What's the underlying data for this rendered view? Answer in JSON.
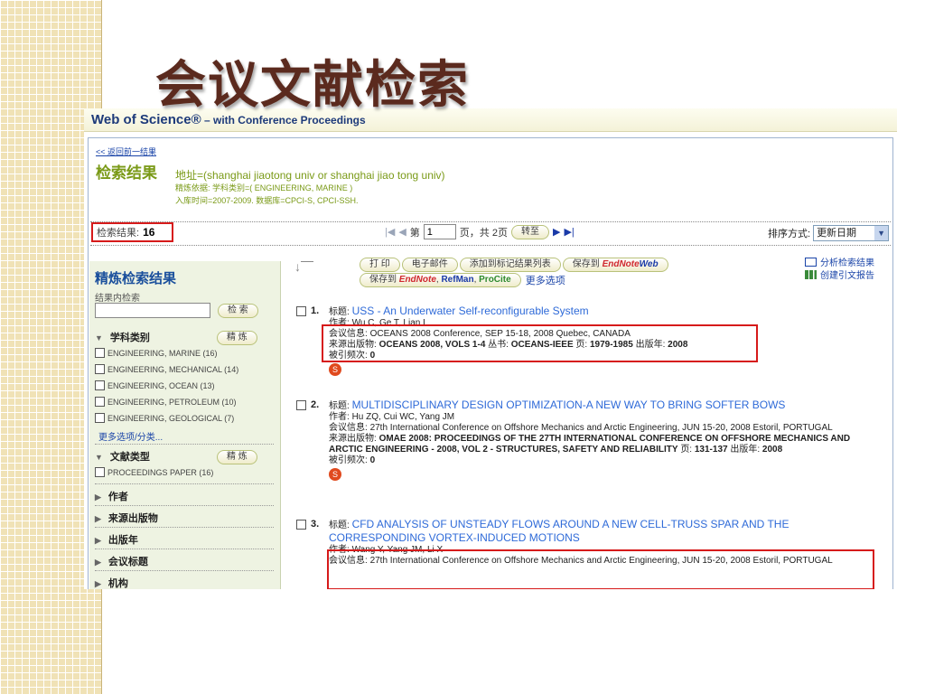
{
  "slide": {
    "title": "会议文献检索"
  },
  "wos": {
    "brand": "Web of Science®",
    "subtitle": " – with Conference Proceedings"
  },
  "results": {
    "back_link": "<< 返回前一结果",
    "heading": "检索结果",
    "query": "地址=(shanghai jiaotong univ or shanghai jiao tong univ)",
    "refine": "精炼依据: 学科类别=( ENGINEERING, MARINE )",
    "date_range": "入库时间=2007-2009. 数据库=CPCI-S, CPCI-SSH.",
    "count_label": "检索结果:",
    "count_value": "16"
  },
  "pager": {
    "prefix": "第",
    "page": "1",
    "suffix": "页，共 2页",
    "go_label": "转至"
  },
  "sort": {
    "label": "排序方式:",
    "value": "更新日期"
  },
  "sidebar": {
    "title": "精炼检索结果",
    "search_label": "结果内检索",
    "search_btn": "检 索",
    "refine_btn": "精 炼",
    "subject": {
      "label": "学科类别",
      "items": [
        "ENGINEERING, MARINE (16)",
        "ENGINEERING, MECHANICAL (14)",
        "ENGINEERING, OCEAN (13)",
        "ENGINEERING, PETROLEUM (10)",
        "ENGINEERING, GEOLOGICAL (7)"
      ],
      "more": "更多选项/分类..."
    },
    "doctype": {
      "label": "文献类型",
      "items": [
        "PROCEEDINGS PAPER (16)"
      ]
    },
    "collapsed": [
      "作者",
      "来源出版物",
      "出版年",
      "会议标题",
      "机构"
    ]
  },
  "toolbar": {
    "print": "打 印",
    "email": "电子邮件",
    "add_marked": "添加到标记结果列表",
    "save_to": "保存到",
    "endnote": "EndNote",
    "endnote_web": "Web",
    "save_to2": "保存到",
    "refman": "RefMan",
    "procite": "ProCite",
    "more": "更多选项",
    "analyze": "分析检索结果",
    "citation_report": "创建引文报告"
  },
  "records": [
    {
      "num": "1.",
      "title_label": "标题:",
      "title": "USS - An Underwater Self-reconfigurable System",
      "author_label": "作者:",
      "authors": "Wu C, Ge T, Lian L",
      "conf_label": "会议信息:",
      "conf": "OCEANS 2008 Conference, SEP 15-18, 2008 Quebec, CANADA",
      "source_label": "来源出版物:",
      "source": "OCEANS 2008, VOLS 1-4",
      "series_label": "丛书:",
      "series": "OCEANS-IEEE",
      "pages_label": "页:",
      "pages": "1979-1985",
      "year_label": "出版年:",
      "year": "2008",
      "cited_label": "被引频次:",
      "cited": "0"
    },
    {
      "num": "2.",
      "title_label": "标题:",
      "title": "MULTIDISCIPLINARY DESIGN OPTIMIZATION-A NEW WAY TO BRING SOFTER BOWS",
      "author_label": "作者:",
      "authors": "Hu ZQ, Cui WC, Yang JM",
      "conf_label": "会议信息:",
      "conf": "27th International Conference on Offshore Mechanics and Arctic Engineering, JUN 15-20, 2008 Estoril, PORTUGAL",
      "source_label": "来源出版物:",
      "source": "OMAE 2008: PROCEEDINGS OF THE 27TH INTERNATIONAL CONFERENCE ON OFFSHORE MECHANICS AND ARCTIC ENGINEERING - 2008, VOL 2 - STRUCTURES, SAFETY AND RELIABILITY",
      "pages_label": "页:",
      "pages": "131-137",
      "year_label": "出版年:",
      "year": "2008",
      "cited_label": "被引频次:",
      "cited": "0"
    },
    {
      "num": "3.",
      "title_label": "标题:",
      "title": "CFD ANALYSIS OF UNSTEADY FLOWS AROUND A NEW CELL-TRUSS SPAR AND THE CORRESPONDING VORTEX-INDUCED MOTIONS",
      "author_label": "作者:",
      "authors": "Wang Y, Yang JM, Li X",
      "conf_label": "会议信息:",
      "conf": "27th International Conference on Offshore Mechanics and Arctic Engineering, JUN 15-20, 2008 Estoril, PORTUGAL"
    }
  ],
  "icons": {
    "first": "first-page-icon",
    "prev": "prev-page-icon",
    "next": "next-page-icon",
    "last": "last-page-icon"
  },
  "colors": {
    "highlight": "#d61a1a",
    "link": "#2e6ad8",
    "heading": "#7a9a17",
    "title_text": "#5b2a1e"
  }
}
